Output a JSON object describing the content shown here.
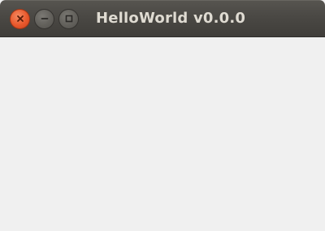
{
  "window": {
    "title": "HelloWorld v0.0.0",
    "controls": {
      "close_icon": "close-icon",
      "minimize_icon": "minimize-icon",
      "maximize_icon": "maximize-icon"
    },
    "colors": {
      "titlebar": "#4a4844",
      "title_text": "#dfdbd2",
      "close_button": "#e9582c",
      "other_buttons": "#62605b",
      "content_background": "#f0f0f0"
    }
  }
}
